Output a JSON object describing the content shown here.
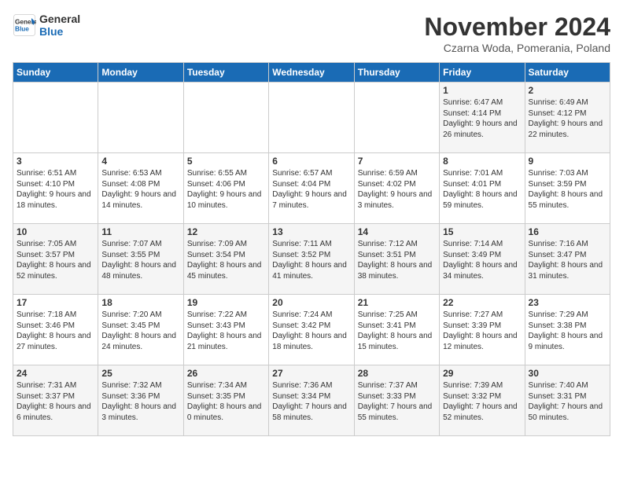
{
  "header": {
    "logo_line1": "General",
    "logo_line2": "Blue",
    "month_title": "November 2024",
    "location": "Czarna Woda, Pomerania, Poland"
  },
  "days_of_week": [
    "Sunday",
    "Monday",
    "Tuesday",
    "Wednesday",
    "Thursday",
    "Friday",
    "Saturday"
  ],
  "weeks": [
    [
      {
        "day": "",
        "info": ""
      },
      {
        "day": "",
        "info": ""
      },
      {
        "day": "",
        "info": ""
      },
      {
        "day": "",
        "info": ""
      },
      {
        "day": "",
        "info": ""
      },
      {
        "day": "1",
        "info": "Sunrise: 6:47 AM\nSunset: 4:14 PM\nDaylight: 9 hours and 26 minutes."
      },
      {
        "day": "2",
        "info": "Sunrise: 6:49 AM\nSunset: 4:12 PM\nDaylight: 9 hours and 22 minutes."
      }
    ],
    [
      {
        "day": "3",
        "info": "Sunrise: 6:51 AM\nSunset: 4:10 PM\nDaylight: 9 hours and 18 minutes."
      },
      {
        "day": "4",
        "info": "Sunrise: 6:53 AM\nSunset: 4:08 PM\nDaylight: 9 hours and 14 minutes."
      },
      {
        "day": "5",
        "info": "Sunrise: 6:55 AM\nSunset: 4:06 PM\nDaylight: 9 hours and 10 minutes."
      },
      {
        "day": "6",
        "info": "Sunrise: 6:57 AM\nSunset: 4:04 PM\nDaylight: 9 hours and 7 minutes."
      },
      {
        "day": "7",
        "info": "Sunrise: 6:59 AM\nSunset: 4:02 PM\nDaylight: 9 hours and 3 minutes."
      },
      {
        "day": "8",
        "info": "Sunrise: 7:01 AM\nSunset: 4:01 PM\nDaylight: 8 hours and 59 minutes."
      },
      {
        "day": "9",
        "info": "Sunrise: 7:03 AM\nSunset: 3:59 PM\nDaylight: 8 hours and 55 minutes."
      }
    ],
    [
      {
        "day": "10",
        "info": "Sunrise: 7:05 AM\nSunset: 3:57 PM\nDaylight: 8 hours and 52 minutes."
      },
      {
        "day": "11",
        "info": "Sunrise: 7:07 AM\nSunset: 3:55 PM\nDaylight: 8 hours and 48 minutes."
      },
      {
        "day": "12",
        "info": "Sunrise: 7:09 AM\nSunset: 3:54 PM\nDaylight: 8 hours and 45 minutes."
      },
      {
        "day": "13",
        "info": "Sunrise: 7:11 AM\nSunset: 3:52 PM\nDaylight: 8 hours and 41 minutes."
      },
      {
        "day": "14",
        "info": "Sunrise: 7:12 AM\nSunset: 3:51 PM\nDaylight: 8 hours and 38 minutes."
      },
      {
        "day": "15",
        "info": "Sunrise: 7:14 AM\nSunset: 3:49 PM\nDaylight: 8 hours and 34 minutes."
      },
      {
        "day": "16",
        "info": "Sunrise: 7:16 AM\nSunset: 3:47 PM\nDaylight: 8 hours and 31 minutes."
      }
    ],
    [
      {
        "day": "17",
        "info": "Sunrise: 7:18 AM\nSunset: 3:46 PM\nDaylight: 8 hours and 27 minutes."
      },
      {
        "day": "18",
        "info": "Sunrise: 7:20 AM\nSunset: 3:45 PM\nDaylight: 8 hours and 24 minutes."
      },
      {
        "day": "19",
        "info": "Sunrise: 7:22 AM\nSunset: 3:43 PM\nDaylight: 8 hours and 21 minutes."
      },
      {
        "day": "20",
        "info": "Sunrise: 7:24 AM\nSunset: 3:42 PM\nDaylight: 8 hours and 18 minutes."
      },
      {
        "day": "21",
        "info": "Sunrise: 7:25 AM\nSunset: 3:41 PM\nDaylight: 8 hours and 15 minutes."
      },
      {
        "day": "22",
        "info": "Sunrise: 7:27 AM\nSunset: 3:39 PM\nDaylight: 8 hours and 12 minutes."
      },
      {
        "day": "23",
        "info": "Sunrise: 7:29 AM\nSunset: 3:38 PM\nDaylight: 8 hours and 9 minutes."
      }
    ],
    [
      {
        "day": "24",
        "info": "Sunrise: 7:31 AM\nSunset: 3:37 PM\nDaylight: 8 hours and 6 minutes."
      },
      {
        "day": "25",
        "info": "Sunrise: 7:32 AM\nSunset: 3:36 PM\nDaylight: 8 hours and 3 minutes."
      },
      {
        "day": "26",
        "info": "Sunrise: 7:34 AM\nSunset: 3:35 PM\nDaylight: 8 hours and 0 minutes."
      },
      {
        "day": "27",
        "info": "Sunrise: 7:36 AM\nSunset: 3:34 PM\nDaylight: 7 hours and 58 minutes."
      },
      {
        "day": "28",
        "info": "Sunrise: 7:37 AM\nSunset: 3:33 PM\nDaylight: 7 hours and 55 minutes."
      },
      {
        "day": "29",
        "info": "Sunrise: 7:39 AM\nSunset: 3:32 PM\nDaylight: 7 hours and 52 minutes."
      },
      {
        "day": "30",
        "info": "Sunrise: 7:40 AM\nSunset: 3:31 PM\nDaylight: 7 hours and 50 minutes."
      }
    ]
  ]
}
